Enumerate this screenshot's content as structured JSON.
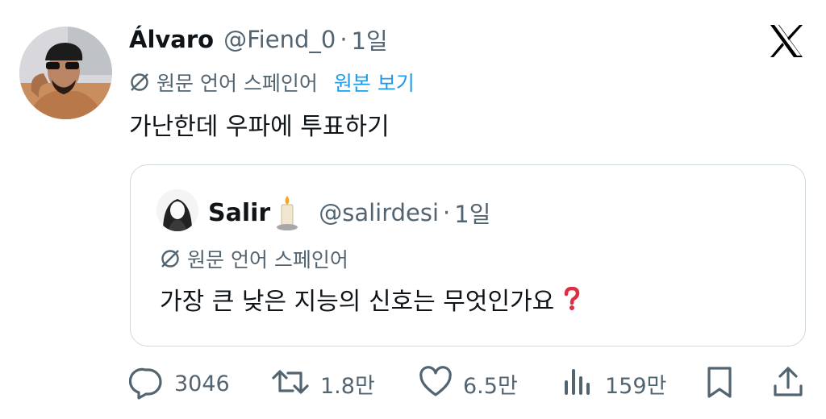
{
  "tweet": {
    "author_name": "Álvaro",
    "author_handle": "@Fiend_0",
    "separator": "·",
    "time": "1일",
    "original_language": "원문 언어 스페인어",
    "show_original": "원본 보기",
    "text": "가난한데 우파에 투표하기"
  },
  "quote": {
    "author_name": "Salir",
    "author_handle": "@salirdesi",
    "separator": "·",
    "time": "1일",
    "original_language": "원문 언어 스페인어",
    "text": "가장 큰 낮은 지능의 신호는 무엇인가요"
  },
  "actions": {
    "replies": "3046",
    "retweets": "1.8만",
    "likes": "6.5만",
    "views": "159만"
  },
  "icons": [
    "x-logo-icon",
    "translate-icon",
    "candle-emoji-icon",
    "question-mark-emoji-icon",
    "reply-icon",
    "retweet-icon",
    "like-icon",
    "views-icon",
    "bookmark-icon",
    "share-icon"
  ],
  "colors": {
    "text": "#0f1419",
    "muted": "#536471",
    "link": "#1d9bf0",
    "border": "#cfd9de",
    "question_mark": "#dd2e44"
  }
}
